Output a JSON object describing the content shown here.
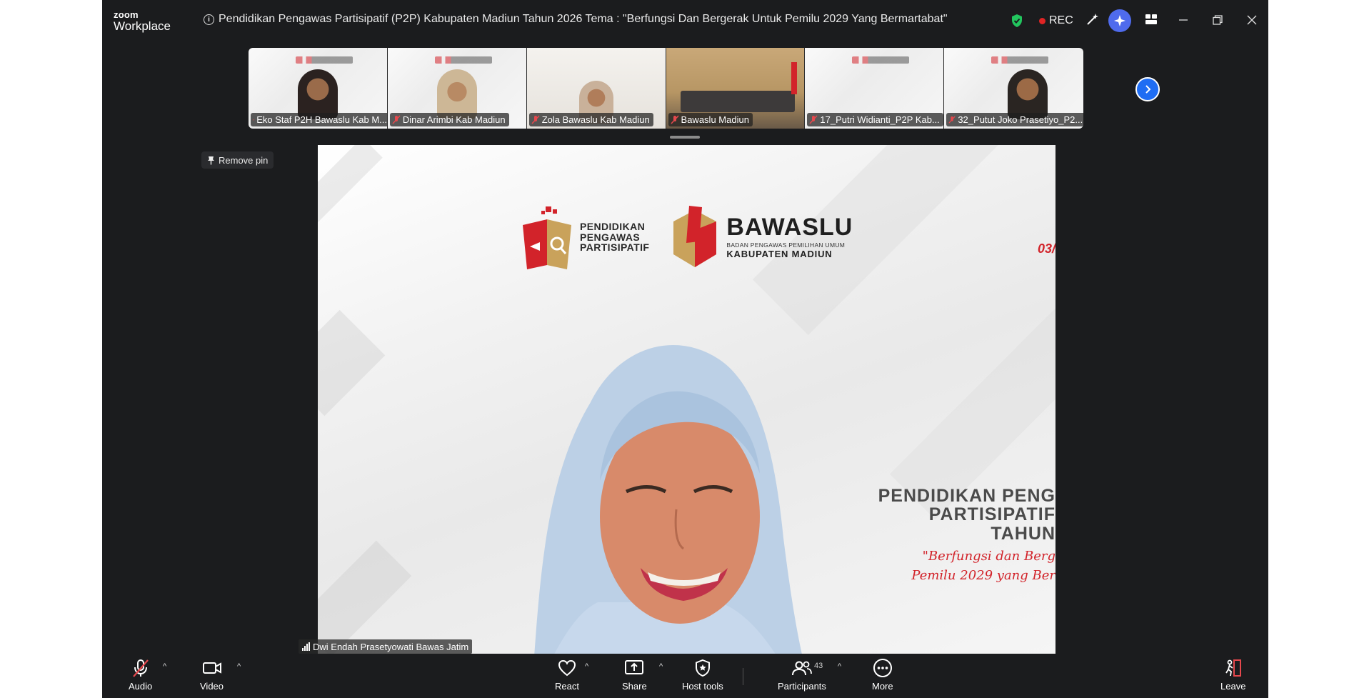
{
  "app": {
    "logo_top": "zoom",
    "logo_bottom": "Workplace"
  },
  "meeting": {
    "title": "Pendidikan Pengawas Partisipatif (P2P) Kabupaten Madiun Tahun 2026 Tema : \"Berfungsi Dan Bergerak Untuk Pemilu 2029 Yang Bermartabat\"",
    "rec_label": "REC"
  },
  "thumbnails": [
    {
      "name": "Eko Staf P2H Bawaslu Kab M...",
      "muted": true
    },
    {
      "name": "Dinar Arimbi Kab Madiun",
      "muted": true
    },
    {
      "name": "Zola Bawaslu Kab Madiun",
      "muted": true
    },
    {
      "name": "Bawaslu Madiun",
      "muted": true
    },
    {
      "name": "17_Putri Widianti_P2P Kab...",
      "muted": true
    },
    {
      "name": "32_Putut Joko Prasetiyo_P2...",
      "muted": true
    }
  ],
  "pin": {
    "label": "Remove pin"
  },
  "main_video": {
    "speaker": "Dwi Endah Prasetyowati Bawas Jatim",
    "slide": {
      "p2p_logo": [
        "PENDIDIKAN",
        "PENGAWAS",
        "PARTISIPATIF"
      ],
      "bawaslu_name": "BAWASLU",
      "bawaslu_sub": "BADAN PENGAWAS PEMILIHAN UMUM",
      "bawaslu_region": "KABUPATEN MADIUN",
      "date_fragment": "03/",
      "title_lines": [
        "PENDIDIKAN PENG",
        "PARTISIPATIF",
        "TAHUN"
      ],
      "quote_lines": [
        "\"Berfungsi dan Berg",
        "Pemilu 2029 yang Ber"
      ]
    }
  },
  "toolbar": {
    "audio": "Audio",
    "video": "Video",
    "react": "React",
    "share": "Share",
    "host_tools": "Host tools",
    "participants": "Participants",
    "participants_count": "43",
    "more": "More",
    "leave": "Leave"
  },
  "colors": {
    "accent_blue": "#1f6df3",
    "rec_red": "#e02424",
    "ai_purple": "#4f6bed",
    "shield_green": "#22c55e",
    "leave_red": "#e5484d"
  }
}
